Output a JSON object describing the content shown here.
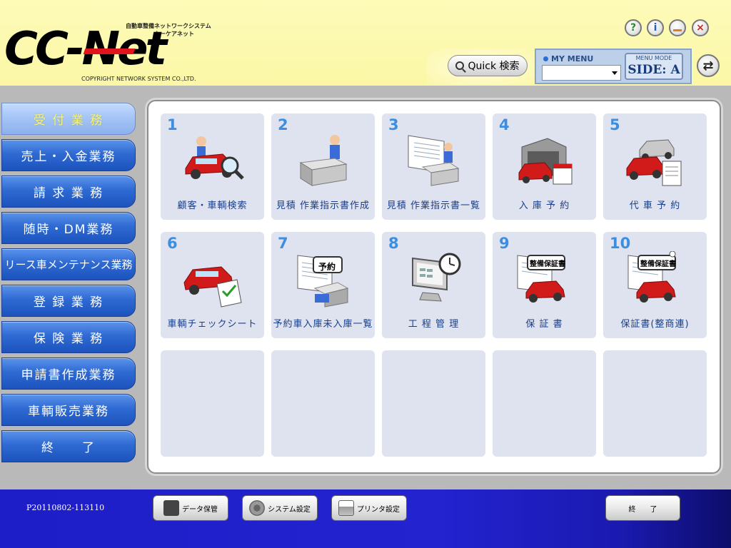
{
  "header": {
    "logo_text": "CC-Net",
    "logo_tagline": "自動車整備ネットワークシステム",
    "logo_sub": "カーケアネット",
    "copyright": "COPYRIGHT NETWORK SYSTEM CO.,LTD.",
    "help_icon": "?",
    "info_icon": "i",
    "close_icon": "×",
    "quick_search_label": "Quick 検索",
    "my_menu_label": "MY MENU",
    "my_menu_value": "",
    "menu_mode_label": "MENU MODE",
    "menu_mode_value": "SIDE: A",
    "switch_icon": "⇄"
  },
  "sidebar": {
    "items": [
      {
        "label": "受 付 業 務",
        "active": true
      },
      {
        "label": "売上・入金業務"
      },
      {
        "label": "請 求 業 務"
      },
      {
        "label": "随時・DM業務"
      },
      {
        "label": "リース車メンテナンス業務"
      },
      {
        "label": "登 録 業 務"
      },
      {
        "label": "保 険 業 務"
      },
      {
        "label": "申請書作成業務"
      },
      {
        "label": "車輌販売業務"
      },
      {
        "label": "終　　了"
      }
    ]
  },
  "tiles": [
    {
      "num": "1",
      "label": "顧客・車輌検索",
      "icon": "car-search-icon"
    },
    {
      "num": "2",
      "label": "見積 作業指示書作成",
      "icon": "desk-person-icon"
    },
    {
      "num": "3",
      "label": "見積 作業指示書一覧",
      "icon": "document-list-icon"
    },
    {
      "num": "4",
      "label": "入 庫 予 約",
      "icon": "garage-calendar-icon"
    },
    {
      "num": "5",
      "label": "代 車 予 約",
      "icon": "cars-document-icon"
    },
    {
      "num": "6",
      "label": "車輌チェックシート",
      "icon": "car-checklist-icon"
    },
    {
      "num": "7",
      "label": "予約車入庫未入庫一覧",
      "icon": "reservation-icon",
      "badge": "予約"
    },
    {
      "num": "8",
      "label": "工 程 管 理",
      "icon": "monitor-clock-icon"
    },
    {
      "num": "9",
      "label": "保 証 書",
      "icon": "warranty-icon",
      "badge": "整備保証書"
    },
    {
      "num": "10",
      "label": "保証書(整商連)",
      "icon": "warranty-seal-icon",
      "badge": "整備保証書"
    }
  ],
  "footer": {
    "version": "P20110802-113110",
    "data_backup_label": "データ保管",
    "system_settings_label": "システム設定",
    "printer_settings_label": "プリンタ設定",
    "exit_label": "終　　了"
  }
}
